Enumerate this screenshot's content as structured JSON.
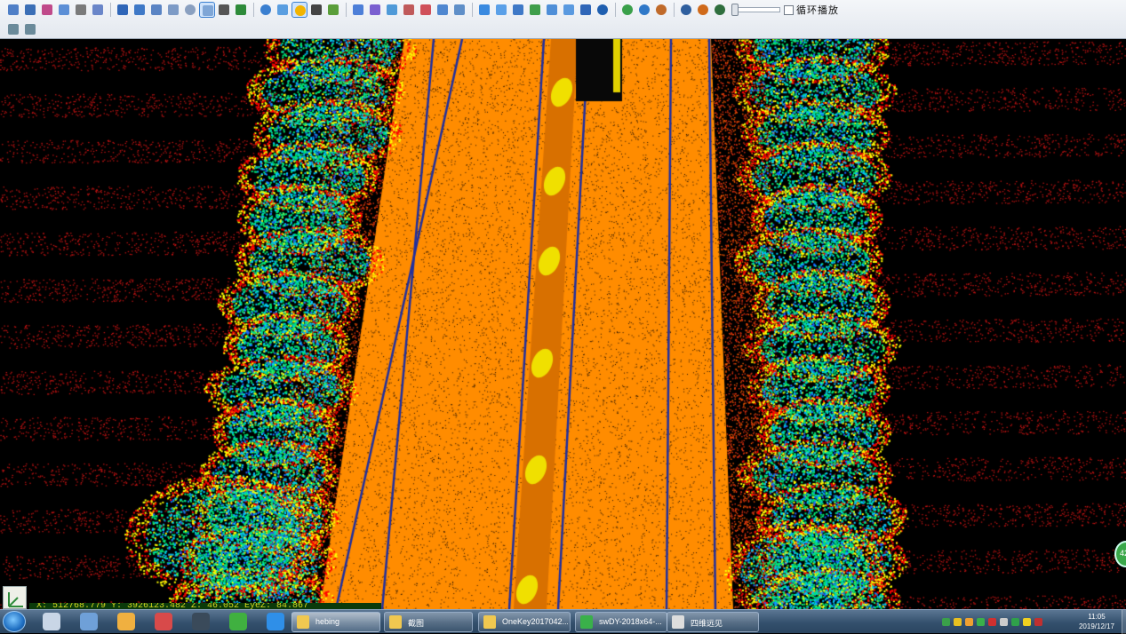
{
  "toolbar": {
    "row1_icons": [
      {
        "name": "pen-icon",
        "color": "#4f7fc7"
      },
      {
        "name": "save-icon",
        "color": "#3b6fb6"
      },
      {
        "name": "layer-icon",
        "color": "#c04a8a"
      },
      {
        "name": "zoom-icon",
        "color": "#5c8fd6"
      },
      {
        "name": "grid-icon",
        "color": "#7b7b7b"
      },
      {
        "name": "edit-icon",
        "color": "#6a86c9"
      },
      {
        "sep": true
      },
      {
        "name": "window-icon",
        "color": "#2f66b8"
      },
      {
        "name": "export-icon",
        "color": "#3f79c7"
      },
      {
        "name": "table-icon",
        "color": "#5a84c4"
      },
      {
        "name": "find-icon",
        "color": "#7d9bc6"
      },
      {
        "name": "compass-icon",
        "color": "#8aa0c0",
        "round": true
      },
      {
        "name": "select-box-icon",
        "color": "#7fa6d6",
        "selected": true
      },
      {
        "name": "tools-icon",
        "color": "#555"
      },
      {
        "name": "tree-icon",
        "color": "#2e8b3a"
      },
      {
        "sep": true
      },
      {
        "name": "eye-icon",
        "color": "#3a7fd0",
        "round": true
      },
      {
        "name": "terrain-icon",
        "color": "#5a9ee0"
      },
      {
        "name": "sun-icon",
        "color": "#f2b400",
        "round": true,
        "selected": true
      },
      {
        "name": "fill-icon",
        "color": "#444"
      },
      {
        "name": "fork-icon",
        "color": "#5a9e3a"
      },
      {
        "sep": true
      },
      {
        "name": "cursor-icon",
        "color": "#4d7fd8"
      },
      {
        "name": "brush-icon",
        "color": "#7a5fd0"
      },
      {
        "name": "curve-icon",
        "color": "#4f9ad8"
      },
      {
        "name": "measure-icon",
        "color": "#c05a5a"
      },
      {
        "name": "calendar-icon",
        "color": "#d0505a"
      },
      {
        "name": "stack-icon",
        "color": "#4f87d0"
      },
      {
        "name": "ruler-icon",
        "color": "#5f8fc8"
      },
      {
        "sep": true
      },
      {
        "name": "diamond-icon",
        "color": "#3a8ae0"
      },
      {
        "name": "cloud-icon",
        "color": "#5aa0e8"
      },
      {
        "name": "bar-icon",
        "color": "#3f79c7"
      },
      {
        "name": "mountain-icon",
        "color": "#3f9e4a"
      },
      {
        "name": "slope-icon",
        "color": "#4f8fd8"
      },
      {
        "name": "pole-icon",
        "color": "#5a9ae0"
      },
      {
        "name": "bucket-icon",
        "color": "#2f66b8"
      },
      {
        "name": "z-plus-icon",
        "color": "#1f5fb0",
        "round": true
      },
      {
        "sep": true
      },
      {
        "name": "globe-green-icon",
        "color": "#3aa04a",
        "round": true
      },
      {
        "name": "globe-blue-icon",
        "color": "#2f78c8",
        "round": true
      },
      {
        "name": "globe-color-icon",
        "color": "#c06a2a",
        "round": true
      },
      {
        "sep": true
      },
      {
        "name": "play-back-icon",
        "color": "#2f5f9e",
        "round": true
      },
      {
        "name": "play-pause-icon",
        "color": "#d06a1a",
        "round": true
      },
      {
        "name": "play-forward-icon",
        "color": "#2f6f3e",
        "round": true
      }
    ],
    "row2_icons": [
      {
        "name": "wave-filter-icon",
        "color": "#6a8a9a"
      },
      {
        "name": "vertical-filter-icon",
        "color": "#6a8a9a"
      }
    ],
    "loop_label": "循环播放"
  },
  "pointcloud": {
    "road_color": "#ff8c00",
    "vegetation_colors": [
      "#00e676",
      "#00c8ff",
      "#1e5fff",
      "#ffff00",
      "#ff0000"
    ],
    "lane_line_color": "#2030a0",
    "ground_color": "#c81414"
  },
  "status": {
    "coordinates": "X: 512768.779 Y: 3926123.482 Z: 46.052 EyeZ: 84.867"
  },
  "side_badge": {
    "label": "42"
  },
  "taskbar": {
    "pinned": [
      {
        "name": "calculator-icon",
        "color": "#c9d6e6"
      },
      {
        "name": "cube-icon",
        "color": "#6fa0d8"
      },
      {
        "name": "paint-icon",
        "color": "#f0b040"
      },
      {
        "name": "snipping-tool-icon",
        "color": "#d84a4a"
      },
      {
        "name": "terminal-icon",
        "color": "#3a4a5a"
      },
      {
        "name": "browser-icon",
        "color": "#40b040"
      },
      {
        "name": "baidu-icon",
        "color": "#2f8fe8"
      }
    ],
    "tasks": [
      {
        "label": "hebing",
        "icon": "folder-icon",
        "color": "#f0c850",
        "active": true
      },
      {
        "label": "截图",
        "icon": "folder-icon",
        "color": "#f0c850"
      },
      {
        "label": "OneKey2017042...",
        "icon": "folder-icon",
        "color": "#f0c850"
      },
      {
        "label": "swDY-2018x64-...",
        "icon": "app-icon",
        "color": "#3ab04a"
      },
      {
        "label": "四维远见",
        "icon": "window-icon",
        "color": "#ddd"
      }
    ],
    "tray_colors": [
      "#3aa04a",
      "#e8c020",
      "#f0a030",
      "#3ab04a",
      "#d03030",
      "#cccccc",
      "#2fa04a",
      "#f0d020",
      "#c03030"
    ],
    "time": "11:05",
    "date": "2019/12/17"
  }
}
